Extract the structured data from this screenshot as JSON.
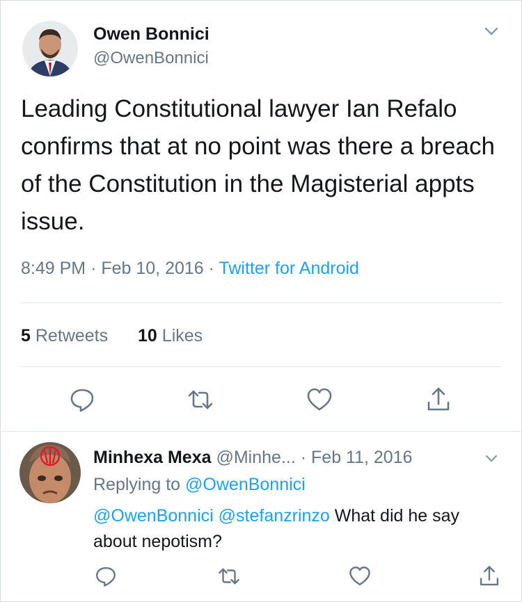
{
  "tweet": {
    "author_name": "Owen Bonnici",
    "author_handle": "@OwenBonnici",
    "text": "Leading Constitutional lawyer Ian Refalo confirms that at no point was there a breach of the Constitution in the Magisterial appts issue.",
    "time": "8:49 PM",
    "date": "Feb 10, 2016",
    "source": "Twitter for Android",
    "retweets_count": "5",
    "retweets_label": "Retweets",
    "likes_count": "10",
    "likes_label": "Likes"
  },
  "reply": {
    "author_name": "Minhexa Mexa",
    "author_handle": "@Minhe...",
    "date": "Feb 11, 2016",
    "replying_label": "Replying to",
    "replying_to": "@OwenBonnici",
    "mention1": "@OwenBonnici",
    "mention2": "@stefanzrinzo",
    "text": "What did he say about nepotism?"
  },
  "icons": {
    "reply": "reply-icon",
    "retweet": "retweet-icon",
    "like": "heart-icon",
    "share": "share-icon",
    "more": "chevron-down-icon"
  },
  "colors": {
    "text": "#14171a",
    "secondary": "#657786",
    "link": "#1da1f2",
    "divider": "#e1e8ed"
  }
}
